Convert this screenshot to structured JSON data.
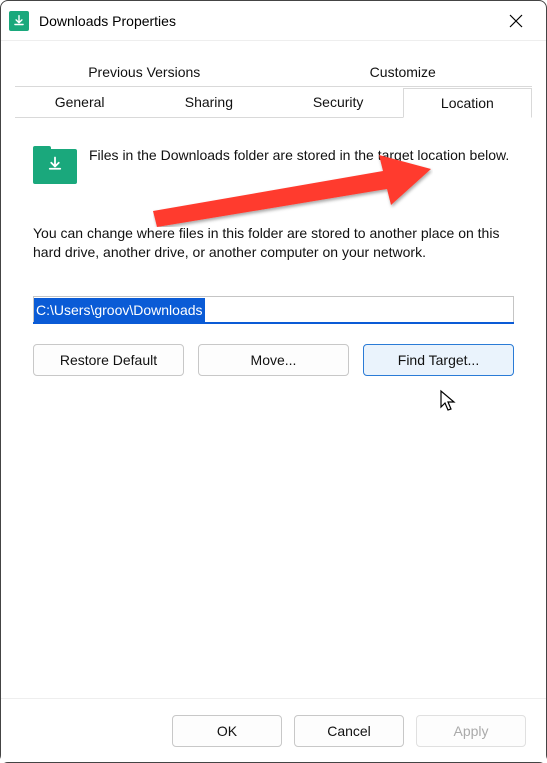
{
  "window": {
    "title": "Downloads Properties"
  },
  "tabs": {
    "row1": [
      "Previous Versions",
      "Customize"
    ],
    "row2": [
      "General",
      "Sharing",
      "Security",
      "Location"
    ],
    "active": "Location"
  },
  "location": {
    "info": "Files in the Downloads folder are stored in the target location below.",
    "description": "You can change where files in this folder are stored to another place on this hard drive, another drive, or another computer on your network.",
    "path": "C:\\Users\\groov\\Downloads",
    "buttons": {
      "restore": "Restore Default",
      "move": "Move...",
      "find": "Find Target..."
    }
  },
  "dialog": {
    "ok": "OK",
    "cancel": "Cancel",
    "apply": "Apply"
  },
  "icons": {
    "app": "download-folder",
    "close": "close"
  }
}
